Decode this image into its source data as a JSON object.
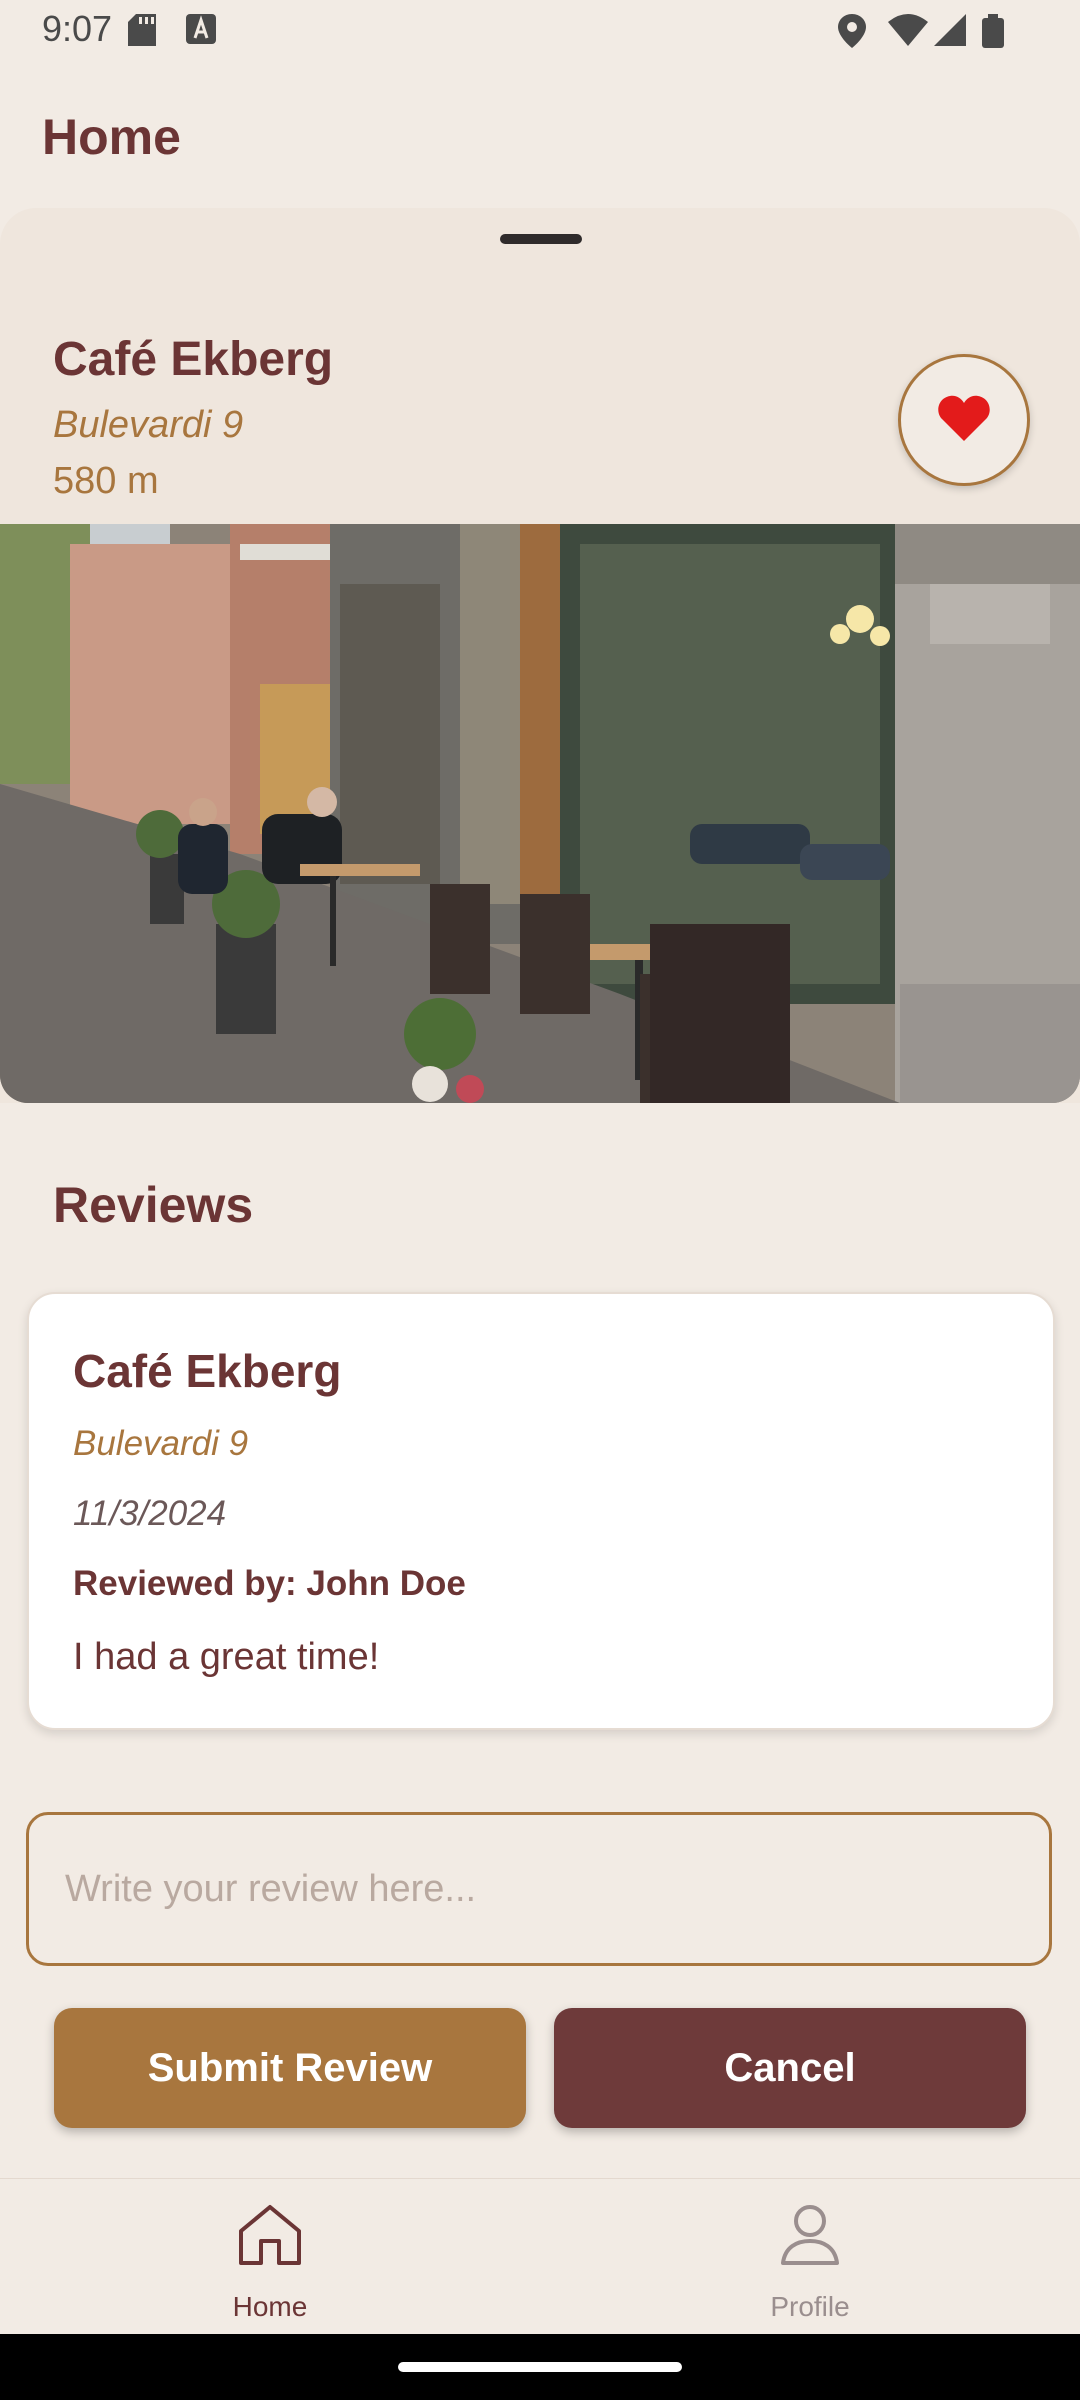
{
  "status_bar": {
    "time": "9:07",
    "left_icons": [
      "sd-card-icon",
      "text-a-icon"
    ],
    "right_icons": [
      "location-icon",
      "wifi-icon",
      "signal-icon",
      "battery-icon"
    ]
  },
  "app_bar": {
    "title": "Home"
  },
  "cafe": {
    "name": "Café Ekberg",
    "address": "Bulevardi 9",
    "distance": "580 m",
    "favorite_icon": "heart-icon",
    "favorited": true
  },
  "reviews": {
    "title": "Reviews",
    "items": [
      {
        "cafe": "Café Ekberg",
        "address": "Bulevardi 9",
        "date": "11/3/2024",
        "reviewer": "Reviewed by: John Doe",
        "text": "I had a great time!"
      }
    ]
  },
  "review_form": {
    "value": "",
    "placeholder": "Write your review here...",
    "submit_label": "Submit Review",
    "cancel_label": "Cancel"
  },
  "bottom_nav": {
    "items": [
      {
        "label": "Home",
        "icon": "home-icon",
        "active": true
      },
      {
        "label": "Profile",
        "icon": "person-icon",
        "active": false
      }
    ]
  },
  "colors": {
    "background": "#F2EBE4",
    "primary": "#6B3535",
    "accent": "#A8763E",
    "favorite": "#E31B1B"
  }
}
